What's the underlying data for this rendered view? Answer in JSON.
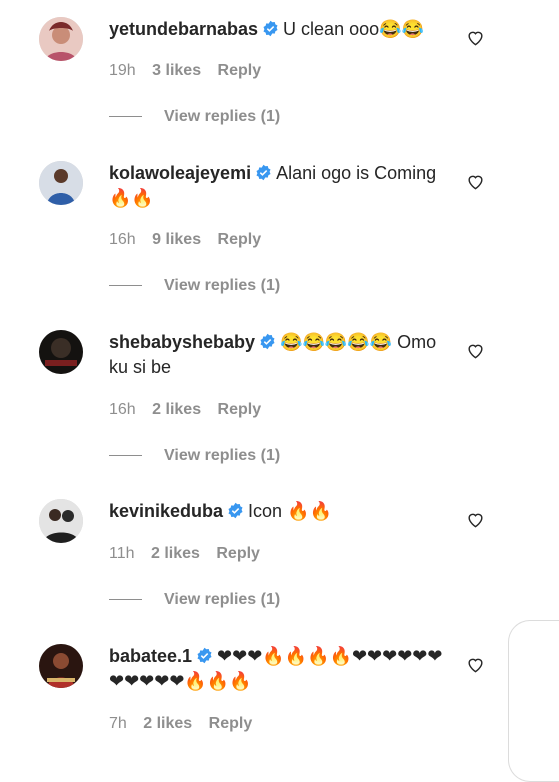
{
  "comments": [
    {
      "username": "yetundebarnabas",
      "text": "U clean ooo😂😂",
      "time": "19h",
      "likes": "3 likes",
      "reply": "Reply",
      "view_replies": "View replies (1)",
      "avatar_color": "#c45a6e"
    },
    {
      "username": "kolawoleajeyemi",
      "text": "Alani ogo is Coming 🔥🔥",
      "time": "16h",
      "likes": "9 likes",
      "reply": "Reply",
      "view_replies": "View replies (1)",
      "avatar_color": "#2f5fa8"
    },
    {
      "username": "shebabyshebaby",
      "text": "😂😂😂😂😂 Omo ku si be",
      "time": "16h",
      "likes": "2 likes",
      "reply": "Reply",
      "view_replies": "View replies (1)",
      "avatar_color": "#2a1f1a"
    },
    {
      "username": "kevinikeduba",
      "text": "Icon 🔥🔥",
      "time": "11h",
      "likes": "2 likes",
      "reply": "Reply",
      "view_replies": "View replies (1)",
      "avatar_color": "#3a3a3a"
    },
    {
      "username": "babatee.1",
      "text": "❤❤❤🔥🔥🔥🔥❤❤❤❤❤❤❤❤❤❤❤🔥🔥🔥",
      "time": "7h",
      "likes": "2 likes",
      "reply": "Reply",
      "avatar_color": "#5a2a1e"
    }
  ],
  "colors": {
    "verified": "#3897f0",
    "muted": "#8e8e8e",
    "text": "#262626"
  },
  "icons": {
    "like": "heart-outline-icon",
    "verified": "verified-badge-icon"
  }
}
